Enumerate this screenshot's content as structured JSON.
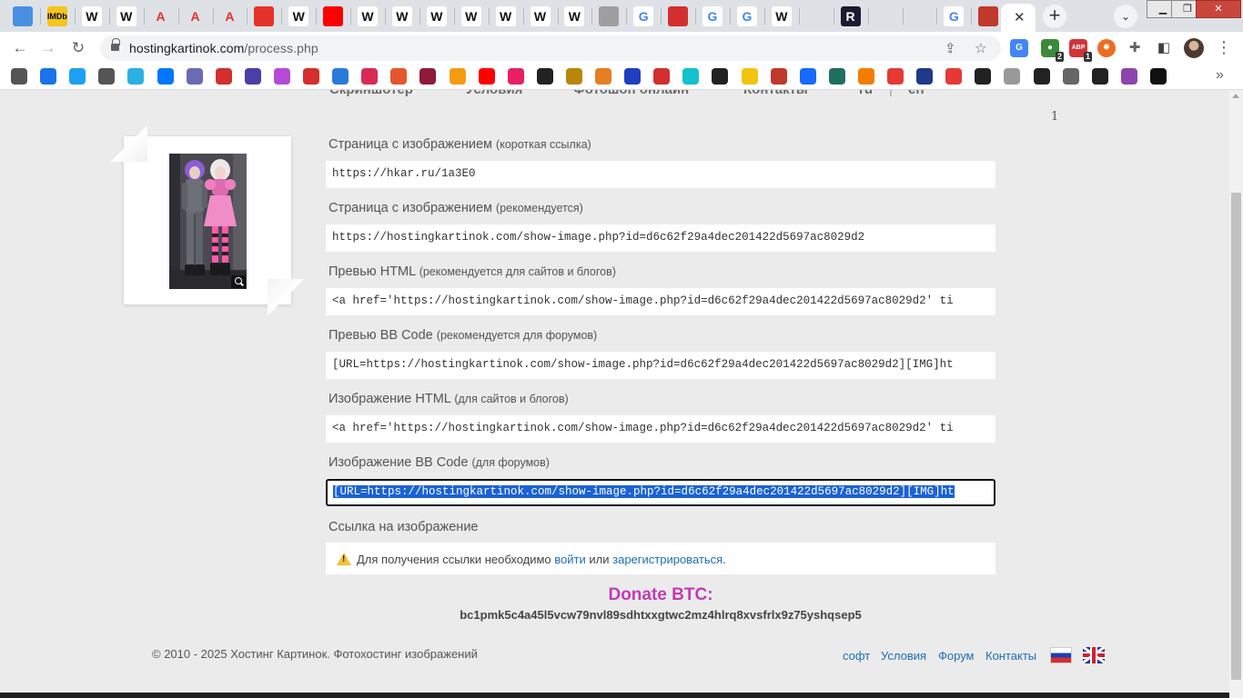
{
  "browser": {
    "tabs": [
      {
        "icon": "bar-chart-icon",
        "label": ""
      },
      {
        "icon": "imdb-icon",
        "label": "IMDb"
      },
      {
        "icon": "wikipedia-icon",
        "label": "W"
      },
      {
        "icon": "wikipedia-icon",
        "label": "W"
      },
      {
        "icon": "red-a-icon",
        "label": "A"
      },
      {
        "icon": "red-a-icon",
        "label": "A"
      },
      {
        "icon": "red-a-icon",
        "label": "A"
      },
      {
        "icon": "record-icon",
        "label": ""
      },
      {
        "icon": "wikipedia-icon",
        "label": "W"
      },
      {
        "icon": "youtube-icon",
        "label": ""
      },
      {
        "icon": "wikipedia-icon",
        "label": "W"
      },
      {
        "icon": "wikipedia-icon",
        "label": "W"
      },
      {
        "icon": "wikipedia-icon",
        "label": "W"
      },
      {
        "icon": "wikipedia-icon",
        "label": "W"
      },
      {
        "icon": "wikipedia-icon",
        "label": "W"
      },
      {
        "icon": "wikipedia-icon",
        "label": "W"
      },
      {
        "icon": "wikipedia-icon",
        "label": "W"
      },
      {
        "icon": "video-icon",
        "label": ""
      },
      {
        "icon": "google-icon",
        "label": "G"
      },
      {
        "icon": "app-icon",
        "label": ""
      },
      {
        "icon": "google-icon",
        "label": "G"
      },
      {
        "icon": "google-icon",
        "label": "G"
      },
      {
        "icon": "wikipedia-icon",
        "label": "W"
      },
      {
        "icon": "city-icon",
        "label": ""
      },
      {
        "icon": "r-logo-icon",
        "label": "R"
      },
      {
        "icon": "bird-icon",
        "label": ""
      },
      {
        "icon": "crescent-icon",
        "label": ""
      },
      {
        "icon": "google-icon",
        "label": "G"
      },
      {
        "icon": "art-icon",
        "label": ""
      }
    ],
    "active_tab_close": "✕",
    "new_tab": "+",
    "url_host": "hostingkartinok.com",
    "url_path": "/process.php",
    "window_controls": {
      "minimize": "▁",
      "maximize": "❐",
      "close": "✕"
    },
    "extension_badges": {
      "first": "2",
      "second": "1"
    },
    "extension_abp": "ABP"
  },
  "page": {
    "top_menu": [
      "Скриншотер",
      "Условия",
      "Фотошоп онлайн",
      "Контакты",
      "ru",
      "en"
    ],
    "lang_separator": "|",
    "counter": "1",
    "fields": [
      {
        "label": "Страница с изображением",
        "hint": "(короткая ссылка)",
        "value": "https://hkar.ru/1a3E0"
      },
      {
        "label": "Страница с изображением",
        "hint": "(рекомендуется)",
        "value": "https://hostingkartinok.com/show-image.php?id=d6c62f29a4dec201422d5697ac8029d2"
      },
      {
        "label": "Превью HTML",
        "hint": "(рекомендуется для сайтов и блогов)",
        "value": "<a href='https://hostingkartinok.com/show-image.php?id=d6c62f29a4dec201422d5697ac8029d2' ti"
      },
      {
        "label": "Превью BB Code",
        "hint": "(рекомендуется для форумов)",
        "value": "[URL=https://hostingkartinok.com/show-image.php?id=d6c62f29a4dec201422d5697ac8029d2][IMG]ht"
      },
      {
        "label": "Изображение HTML",
        "hint": "(для сайтов и блогов)",
        "value": "<a href='https://hostingkartinok.com/show-image.php?id=d6c62f29a4dec201422d5697ac8029d2' ti"
      },
      {
        "label": "Изображение BB Code",
        "hint": "(для форумов)",
        "value": "[URL=https://hostingkartinok.com/show-image.php?id=d6c62f29a4dec201422d5697ac8029d2][IMG]ht"
      }
    ],
    "image_link": {
      "label": "Ссылка на изображение",
      "notice_before": "Для получения ссылки необходимо",
      "login": "войти",
      "or": "или",
      "register": "зарегистрироваться",
      "notice_after": "."
    },
    "donate": {
      "title": "Donate BTC:",
      "address": "bc1pmk5c4a45l5vcw79nvl89sdhtxxgtwc2mz4hlrq8xvsfrlx9z75yshqsep5"
    },
    "footer": {
      "copyright": "© 2010 - 2025 Хостинг Картинок. Фотохостинг изображений",
      "links": [
        "софт",
        "Условия",
        "Форум",
        "Контакты"
      ]
    }
  },
  "colors": {
    "page_bg": "#ebebeb",
    "link": "#1e6fb4",
    "donate": "#c23bb4",
    "selection": "#1a62d6"
  }
}
